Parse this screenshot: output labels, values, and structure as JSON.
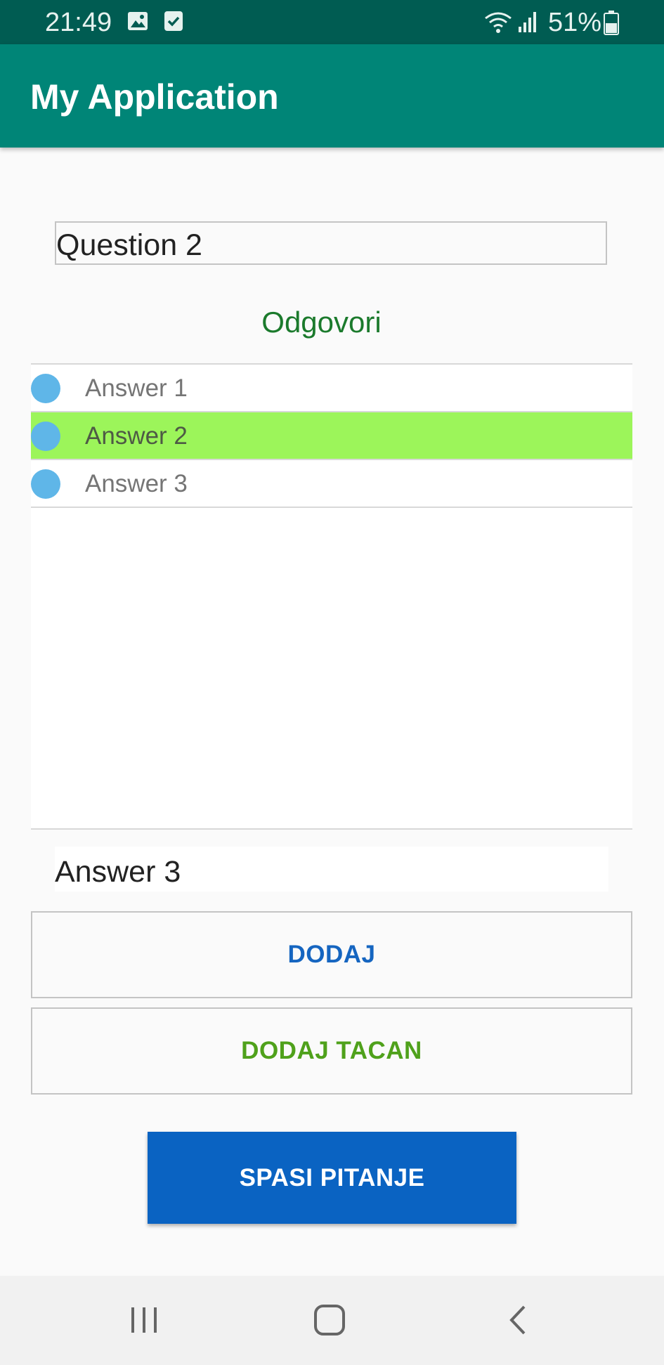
{
  "status_bar": {
    "time": "21:49",
    "battery": "51%",
    "icons": [
      "gallery-icon",
      "checkbox-icon",
      "wifi-icon",
      "signal-icon",
      "battery-icon"
    ]
  },
  "app_bar": {
    "title": "My Application"
  },
  "question": {
    "value": "Question 2"
  },
  "answers_section": {
    "title": "Odgovori",
    "items": [
      {
        "label": "Answer 1",
        "correct": false
      },
      {
        "label": "Answer 2",
        "correct": true
      },
      {
        "label": "Answer 3",
        "correct": false
      }
    ]
  },
  "answer_input": {
    "value": "Answer 3"
  },
  "buttons": {
    "add": "DODAJ",
    "add_correct": "DODAJ TACAN",
    "save_question": "SPASI PITANJE"
  },
  "nav_bar": {
    "icons": [
      "recents-icon",
      "home-icon",
      "back-icon"
    ]
  },
  "colors": {
    "status_bar": "#005c52",
    "app_bar": "#008577",
    "correct_highlight": "#9cf55a",
    "answer_dot": "#5fb6e8",
    "section_title": "#1b7a2c",
    "add_text": "#1565c0",
    "add_correct_text": "#4fa11b",
    "save_button": "#0a63c2"
  }
}
